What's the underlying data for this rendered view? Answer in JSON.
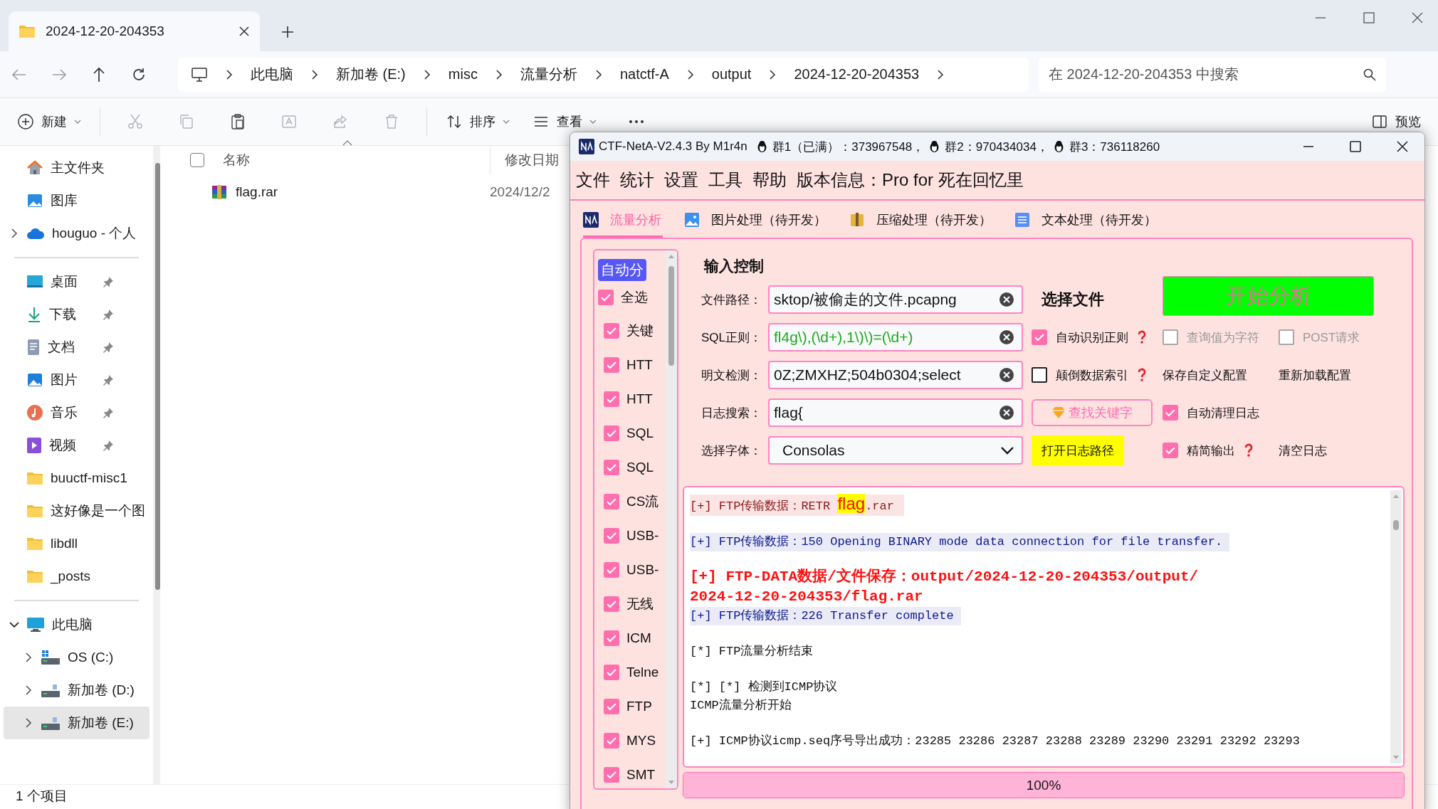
{
  "explorer": {
    "tab": {
      "title": "2024-12-20-204353"
    },
    "breadcrumb": [
      "此电脑",
      "新加卷 (E:)",
      "misc",
      "流量分析",
      "natctf-A",
      "output",
      "2024-12-20-204353"
    ],
    "search": {
      "placeholder": "在 2024-12-20-204353 中搜索"
    },
    "toolbar": {
      "new": "新建",
      "sort": "排序",
      "view": "查看",
      "preview": "预览"
    },
    "nav": [
      {
        "items": [
          {
            "label": "主文件夹",
            "selected": false
          },
          {
            "label": "图库",
            "selected": false
          },
          {
            "label": "houguo - 个人",
            "selected": false,
            "expanded": false
          }
        ]
      },
      {
        "items": [
          {
            "label": "桌面",
            "pinned": true,
            "selected": false
          },
          {
            "label": "下载",
            "pinned": true,
            "selected": false
          },
          {
            "label": "文档",
            "pinned": true,
            "selected": false
          },
          {
            "label": "图片",
            "pinned": true,
            "selected": false
          },
          {
            "label": "音乐",
            "pinned": true,
            "selected": false
          },
          {
            "label": "视频",
            "pinned": true,
            "selected": false
          },
          {
            "label": "buuctf-misc1",
            "selected": false
          },
          {
            "label": "这好像是一个图",
            "selected": false
          },
          {
            "label": "libdll",
            "selected": false
          },
          {
            "label": "_posts",
            "selected": false
          }
        ]
      },
      {
        "items": [
          {
            "label": "此电脑",
            "selected": false,
            "expanded": true,
            "children": [
              {
                "label": "OS (C:)",
                "selected": false,
                "expanded": false
              },
              {
                "label": "新加卷 (D:)",
                "selected": false,
                "expanded": false
              },
              {
                "label": "新加卷 (E:)",
                "selected": true,
                "expanded": false
              }
            ]
          }
        ]
      }
    ],
    "select_all": {
      "checked": false
    },
    "columns": [
      "名称",
      "修改日期"
    ],
    "files": [
      {
        "name": "flag.rar",
        "date": "2024/12/2"
      }
    ],
    "status": "1 个项目"
  },
  "app": {
    "title": "CTF-NetA-V2.4.3 By M1r4n",
    "groups": [
      "群1（已满）：373967548，",
      "群2：970434034，",
      "群3：736118260"
    ],
    "menu": [
      "文件",
      "统计",
      "设置",
      "工具",
      "帮助",
      "版本信息：Pro for 死在回忆里"
    ],
    "tabs": [
      {
        "label": "流量分析",
        "selected": true
      },
      {
        "label": "图片处理（待开发）",
        "selected": false
      },
      {
        "label": "压缩处理（待开发）",
        "selected": false
      },
      {
        "label": "文本处理（待开发）",
        "selected": false
      }
    ],
    "protocols": {
      "header": "自动分",
      "items": [
        {
          "label": "全选",
          "checked": true
        },
        {
          "label": "关键",
          "checked": true
        },
        {
          "label": "HTT",
          "checked": true
        },
        {
          "label": "HTT",
          "checked": true
        },
        {
          "label": "SQL",
          "checked": true
        },
        {
          "label": "SQL",
          "checked": true
        },
        {
          "label": "CS流",
          "checked": true
        },
        {
          "label": "USB-",
          "checked": true
        },
        {
          "label": "USB-",
          "checked": true
        },
        {
          "label": "无线",
          "checked": true
        },
        {
          "label": "ICM",
          "checked": true
        },
        {
          "label": "Telne",
          "checked": true
        },
        {
          "label": "FTP",
          "checked": true
        },
        {
          "label": "MYS",
          "checked": true
        },
        {
          "label": "SMT",
          "checked": true
        }
      ]
    },
    "section_title": "输入控制",
    "fields": [
      {
        "label": "文件路径：",
        "value": "sktop/被偷走的文件.pcapng",
        "kind": "text",
        "controls": [
          {
            "kind": "link",
            "label": "选择文件"
          },
          {
            "kind": "start",
            "label": "开始分析"
          }
        ]
      },
      {
        "label": "SQL正则：",
        "value": "fl4g\\),(\\d+),1\\)\\)=(\\d+)",
        "kind": "regex",
        "controls": [
          {
            "kind": "check",
            "label": "自动识别正则",
            "checked": true,
            "disabled": false,
            "help": true
          },
          {
            "kind": "check",
            "label": "查询值为字符",
            "checked": false,
            "disabled": true,
            "help": false
          },
          {
            "kind": "check",
            "label": "POST请求",
            "checked": false,
            "disabled": true,
            "help": false
          }
        ]
      },
      {
        "label": "明文检测：",
        "value": "0Z;ZMXHZ;504b0304;select",
        "kind": "text",
        "controls": [
          {
            "kind": "check",
            "label": "颠倒数据索引",
            "checked": false,
            "disabled": false,
            "help": true
          },
          {
            "kind": "plain",
            "label": "保存自定义配置"
          },
          {
            "kind": "plain",
            "label": "重新加载配置"
          }
        ]
      },
      {
        "label": "日志搜索：",
        "value": "flag{",
        "kind": "text",
        "controls": [
          {
            "kind": "search",
            "label": "查找关键字"
          },
          {
            "kind": "check",
            "label": "自动清理日志",
            "checked": true,
            "disabled": false,
            "help": false
          }
        ]
      },
      {
        "label": "选择字体：",
        "value": "Consolas",
        "kind": "select",
        "controls": [
          {
            "kind": "yellow",
            "label": "打开日志路径"
          },
          {
            "kind": "check",
            "label": "精简输出",
            "checked": true,
            "disabled": false,
            "help": true
          },
          {
            "kind": "plain",
            "label": "清空日志"
          }
        ]
      }
    ],
    "log": [
      {
        "kind": "retr",
        "segments": [
          {
            "text": "[+] FTP传输数据：RETR ",
            "highlight": false
          },
          {
            "text": "flag",
            "highlight": true
          },
          {
            "text": ".rar",
            "highlight": false
          }
        ]
      },
      {
        "kind": "info",
        "text": "[+] FTP传输数据：150 Opening BINARY mode data connection for file transfer."
      },
      {
        "kind": "saved",
        "text": "[+] FTP-DATA数据/文件保存：output/2024-12-20-204353/output/\n2024-12-20-204353/flag.rar"
      },
      {
        "kind": "info",
        "text": "[+] FTP传输数据：226 Transfer complete"
      },
      {
        "kind": "plain",
        "text": "[*] FTP流量分析结束"
      },
      {
        "kind": "plain",
        "text": "[*] [*] 检测到ICMP协议\nICMP流量分析开始"
      },
      {
        "kind": "plain",
        "text": "[+] ICMP协议icmp.seq序号导出成功：23285 23286 23287 23288 23289 23290 23291 23292 23293"
      }
    ],
    "progress": {
      "level": 1,
      "label": "100%"
    }
  }
}
